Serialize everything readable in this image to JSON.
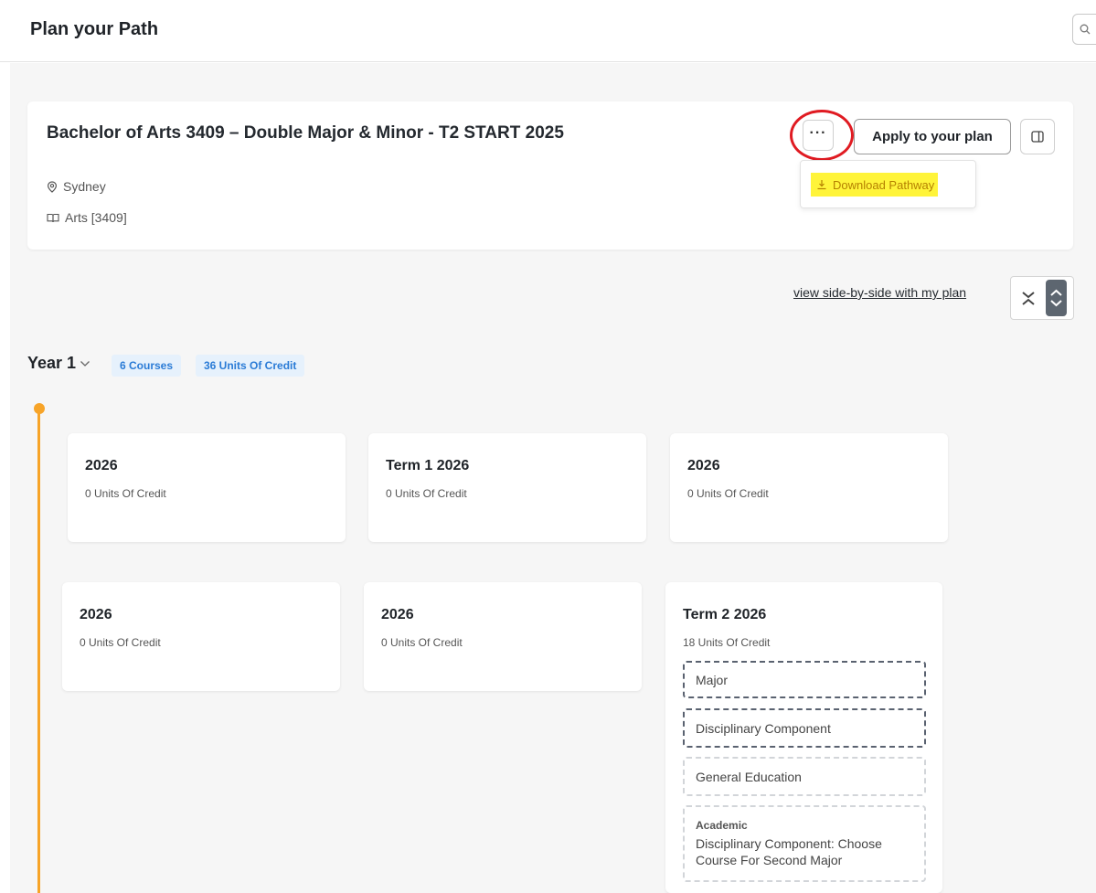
{
  "header": {
    "title": "Plan your Path"
  },
  "search": {
    "icon": "search-icon"
  },
  "program": {
    "title": "Bachelor of Arts 3409 – Double Major & Minor - T2 START 2025",
    "location": "Sydney",
    "faculty": "Arts [3409]"
  },
  "actions": {
    "more_label": "···",
    "apply_label": "Apply to your plan",
    "download_label": "Download Pathway"
  },
  "view": {
    "side_by_side_label": "view side-by-side with my plan"
  },
  "year": {
    "label": "Year 1",
    "courses_badge": "6 Courses",
    "credit_badge": "36 Units Of Credit"
  },
  "terms": [
    {
      "title": "2026",
      "credit": "0 Units Of Credit"
    },
    {
      "title": "Term 1 2026",
      "credit": "0 Units Of Credit"
    },
    {
      "title": "2026",
      "credit": "0 Units Of Credit"
    },
    {
      "title": "2026",
      "credit": "0 Units Of Credit"
    },
    {
      "title": "2026",
      "credit": "0 Units Of Credit"
    },
    {
      "title": "Term 2 2026",
      "credit": "18 Units Of Credit",
      "slots": [
        {
          "label": "Major"
        },
        {
          "label": "Disciplinary Component"
        },
        {
          "label": "General Education"
        },
        {
          "category": "Academic",
          "label": "Disciplinary Component: Choose Course For Second Major"
        }
      ]
    }
  ],
  "colors": {
    "accent_timeline": "#f7a428",
    "badge_bg": "#e6f1fc",
    "badge_text": "#2a7bd6",
    "highlight": "#fff43a",
    "annotation_ring": "#e01b22"
  }
}
